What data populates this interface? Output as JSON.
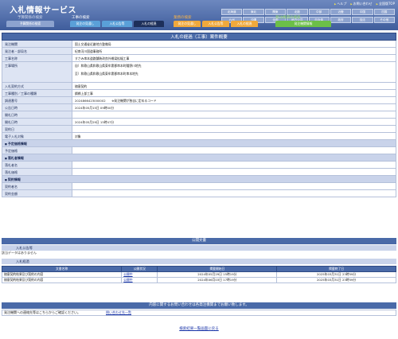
{
  "header": {
    "title": "入札情報サービス",
    "top_links": [
      "ヘルプ",
      "お問い合わせ",
      "全国版TOP"
    ],
    "regions_row1": [
      "北海道",
      "東北",
      "関東",
      "北陸",
      "中部",
      "近畿",
      "中国",
      "四国"
    ],
    "regions_row2": [
      "九州",
      "沖縄",
      "全国",
      "地方公共",
      "自治体",
      "政府",
      "独法",
      "その他"
    ]
  },
  "nav": {
    "ppi_label": "予算関係の検索",
    "kouji_label": "工事の検索",
    "gyomu_label": "業務の検索",
    "hachu_label": "発注機関の検索",
    "ppi_buttons": [
      "予算関係の検索"
    ],
    "kouji_buttons": [
      "発注の見通し",
      "入札公告等",
      "入札の経過"
    ],
    "gyomu_buttons": [
      "発注の見通し",
      "入札公告等",
      "入札の経過"
    ],
    "hachu_buttons": [
      "発注機関情報"
    ]
  },
  "case": {
    "heading": "入札の経過（工事）案件概要",
    "rows": [
      {
        "k": "発注機関",
        "v": "国土交通省近畿地方整備局"
      },
      {
        "k": "発注者・部局名",
        "v": "紀南河川国道事務所"
      },
      {
        "k": "工事名称",
        "v": "すさみ串本道路舗装改良外橋梁拡幅工事"
      },
      {
        "k": "工事場所",
        "v1": "自）和歌山県和歌山県東牟婁郡串本町鬮野川地先",
        "v2": "至）和歌山県和歌山県東牟婁郡串本町串本地先"
      },
      {
        "k": "入札契約方式",
        "v": "随意契約"
      },
      {
        "k": "工事種別／工事の種類",
        "v": "鋼橋上部工事"
      },
      {
        "k": "調達番号",
        "v": "2024866423000002　　※発注機関が独自に定めるコード"
      },
      {
        "k": "公告日時",
        "v": "2024年05月15日 09時00分"
      },
      {
        "k": "開札日時",
        "v": ""
      },
      {
        "k": "開札日時",
        "v": "2024年05月29日 15時47分"
      },
      {
        "k": "契約日",
        "v": ""
      },
      {
        "k": "電子入札対象",
        "v": "対象"
      },
      {
        "k": "予定価格情報",
        "v": ""
      },
      {
        "k": "予定価格",
        "v": ""
      },
      {
        "k": "落札者情報",
        "v": ""
      },
      {
        "k": "落札者名",
        "v": ""
      },
      {
        "k": "落札価格",
        "v": ""
      },
      {
        "k": "契約情報",
        "v": ""
      },
      {
        "k": "契約者名",
        "v": ""
      },
      {
        "k": "契約金額",
        "v": ""
      }
    ]
  },
  "documents": {
    "heading": "公開文書",
    "notice_heading": "入札公告等",
    "notice_empty": "該当データはありません",
    "progress_heading": "入札経過",
    "columns": [
      "文書名称",
      "公開状況",
      "掲載開始日",
      "掲載終了日"
    ],
    "rows": [
      [
        "随意契約結果及び契約の内容",
        "公開中",
        "2024年05月29日 15時19分",
        "2025年03月31日 23時59分"
      ],
      [
        "随意契約結果及び契約の内容",
        "公開中",
        "2024年06月03日 17時19分",
        "2025年03月31日 23時59分"
      ]
    ]
  },
  "contact": {
    "heading": "内容に関するお問い合わせは各発注機関までお願い致します。",
    "label": "発注機関への連絡先等はこちらからご確認ください。",
    "link": "問い合わせ先一覧"
  },
  "back_link": "検索結果一覧画面に戻る",
  "colors": {
    "header": "#4a6aa8",
    "section": "#c9d3ea",
    "key": "#dde4f3"
  }
}
